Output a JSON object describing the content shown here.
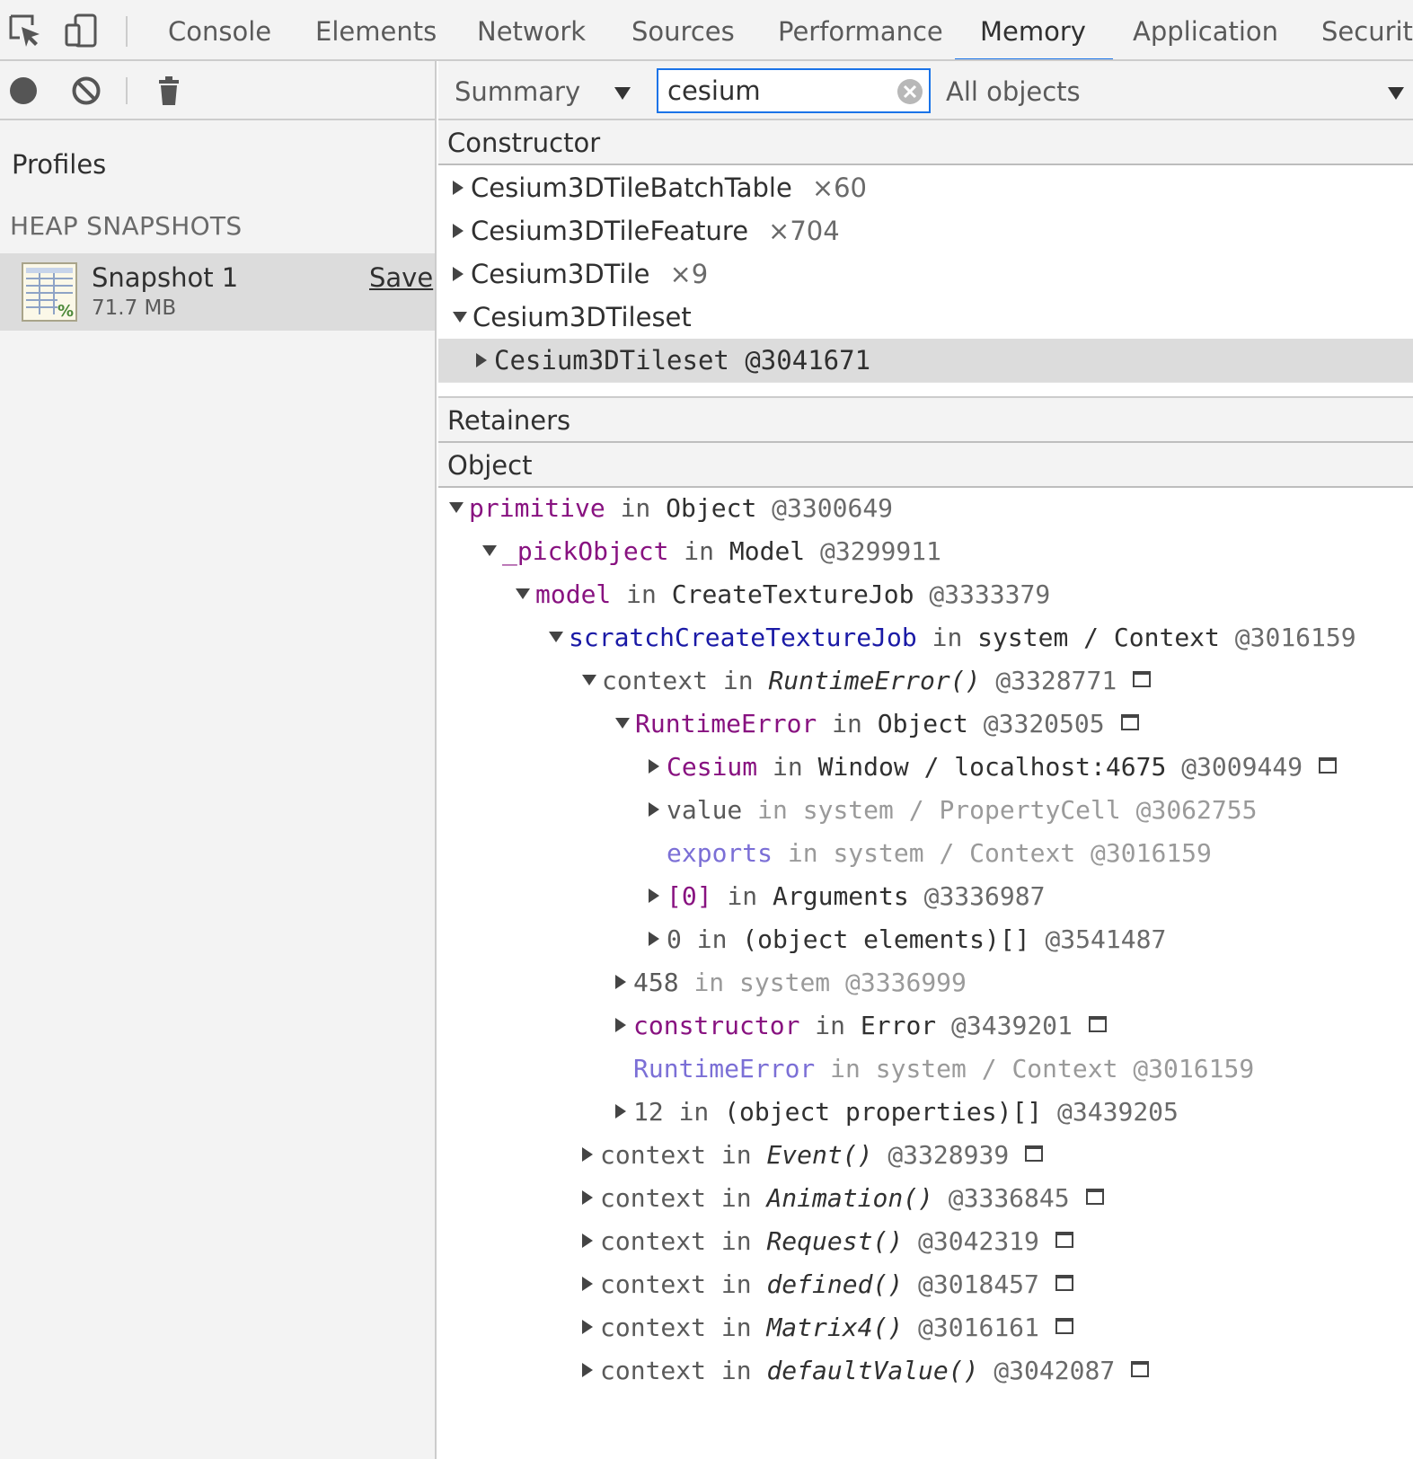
{
  "toolbar": {
    "tabs": [
      "Console",
      "Elements",
      "Network",
      "Sources",
      "Performance",
      "Memory",
      "Application",
      "Security"
    ],
    "active_tab": "Memory"
  },
  "profiles": {
    "title": "Profiles",
    "section": "HEAP SNAPSHOTS",
    "snapshot": {
      "name": "Snapshot 1",
      "size": "71.7 MB",
      "save_label": "Save"
    }
  },
  "filter": {
    "view": "Summary",
    "search_value": "cesium",
    "objects": "All objects"
  },
  "constructors": {
    "header": "Constructor",
    "rows": [
      {
        "name": "Cesium3DTileBatchTable",
        "count": "×60",
        "expanded": false
      },
      {
        "name": "Cesium3DTileFeature",
        "count": "×704",
        "expanded": false
      },
      {
        "name": "Cesium3DTile",
        "count": "×9",
        "expanded": false
      },
      {
        "name": "Cesium3DTileset",
        "count": "",
        "expanded": true
      },
      {
        "name": "Cesium3DTileset @3041671",
        "count": "",
        "expanded": false,
        "selected": true
      }
    ]
  },
  "retainers": {
    "header": "Retainers",
    "column": "Object",
    "rows": [
      {
        "level": 0,
        "state": "down",
        "key": "primitive",
        "kind": "purple",
        "in": "in",
        "obj": "Object",
        "id": "@3300649",
        "italic": false,
        "box": false,
        "dim": false
      },
      {
        "level": 1,
        "state": "down",
        "key": "_pickObject",
        "kind": "purple",
        "in": "in",
        "obj": "Model",
        "id": "@3299911",
        "italic": false,
        "box": false,
        "dim": false
      },
      {
        "level": 2,
        "state": "down",
        "key": "model",
        "kind": "purple",
        "in": "in",
        "obj": "CreateTextureJob",
        "id": "@3333379",
        "italic": false,
        "box": false,
        "dim": false
      },
      {
        "level": 3,
        "state": "down",
        "key": "scratchCreateTextureJob",
        "kind": "blue",
        "in": "in",
        "obj": "system / Context",
        "id": "@3016159",
        "italic": false,
        "box": false,
        "dim": false
      },
      {
        "level": 4,
        "state": "down",
        "key": "context",
        "kind": "gray",
        "in": "in",
        "obj": "RuntimeError()",
        "id": "@3328771",
        "italic": true,
        "box": true,
        "dim": false
      },
      {
        "level": 5,
        "state": "down",
        "key": "RuntimeError",
        "kind": "purple",
        "in": "in",
        "obj": "Object",
        "id": "@3320505",
        "italic": false,
        "box": true,
        "dim": false
      },
      {
        "level": 6,
        "state": "right",
        "key": "Cesium",
        "kind": "purple",
        "in": "in",
        "obj": "Window / localhost:4675",
        "id": "@3009449",
        "italic": false,
        "box": true,
        "dim": false
      },
      {
        "level": 6,
        "state": "right",
        "key": "value",
        "kind": "gray",
        "in": "in",
        "obj": "system / PropertyCell",
        "id": "@3062755",
        "italic": false,
        "box": false,
        "dim": true
      },
      {
        "level": 6,
        "state": "none",
        "key": "exports",
        "kind": "dim",
        "in": "in",
        "obj": "system / Context",
        "id": "@3016159",
        "italic": false,
        "box": false,
        "dim": true
      },
      {
        "level": 6,
        "state": "right",
        "key": "[0]",
        "kind": "purple",
        "in": "in",
        "obj": "Arguments",
        "id": "@3336987",
        "italic": false,
        "box": false,
        "dim": false
      },
      {
        "level": 6,
        "state": "right",
        "key": "0",
        "kind": "gray",
        "in": "in",
        "obj": "(object elements)[]",
        "id": "@3541487",
        "italic": false,
        "box": false,
        "dim": false
      },
      {
        "level": 5,
        "state": "right",
        "key": "458",
        "kind": "gray",
        "in": "in",
        "obj": "system",
        "id": "@3336999",
        "italic": false,
        "box": false,
        "dim": true
      },
      {
        "level": 5,
        "state": "right",
        "key": "constructor",
        "kind": "purple",
        "in": "in",
        "obj": "Error",
        "id": "@3439201",
        "italic": false,
        "box": true,
        "dim": false
      },
      {
        "level": 5,
        "state": "none",
        "key": "RuntimeError",
        "kind": "dim",
        "in": "in",
        "obj": "system / Context",
        "id": "@3016159",
        "italic": false,
        "box": false,
        "dim": true
      },
      {
        "level": 5,
        "state": "right",
        "key": "12",
        "kind": "gray",
        "in": "in",
        "obj": "(object properties)[]",
        "id": "@3439205",
        "italic": false,
        "box": false,
        "dim": false
      },
      {
        "level": 4,
        "state": "right",
        "key": "context",
        "kind": "gray",
        "in": "in",
        "obj": "Event()",
        "id": "@3328939",
        "italic": true,
        "box": true,
        "dim": false
      },
      {
        "level": 4,
        "state": "right",
        "key": "context",
        "kind": "gray",
        "in": "in",
        "obj": "Animation()",
        "id": "@3336845",
        "italic": true,
        "box": true,
        "dim": false
      },
      {
        "level": 4,
        "state": "right",
        "key": "context",
        "kind": "gray",
        "in": "in",
        "obj": "Request()",
        "id": "@3042319",
        "italic": true,
        "box": true,
        "dim": false
      },
      {
        "level": 4,
        "state": "right",
        "key": "context",
        "kind": "gray",
        "in": "in",
        "obj": "defined()",
        "id": "@3018457",
        "italic": true,
        "box": true,
        "dim": false
      },
      {
        "level": 4,
        "state": "right",
        "key": "context",
        "kind": "gray",
        "in": "in",
        "obj": "Matrix4()",
        "id": "@3016161",
        "italic": true,
        "box": true,
        "dim": false
      },
      {
        "level": 4,
        "state": "right",
        "key": "context",
        "kind": "gray",
        "in": "in",
        "obj": "defaultValue()",
        "id": "@3042087",
        "italic": true,
        "box": true,
        "dim": false
      }
    ]
  }
}
